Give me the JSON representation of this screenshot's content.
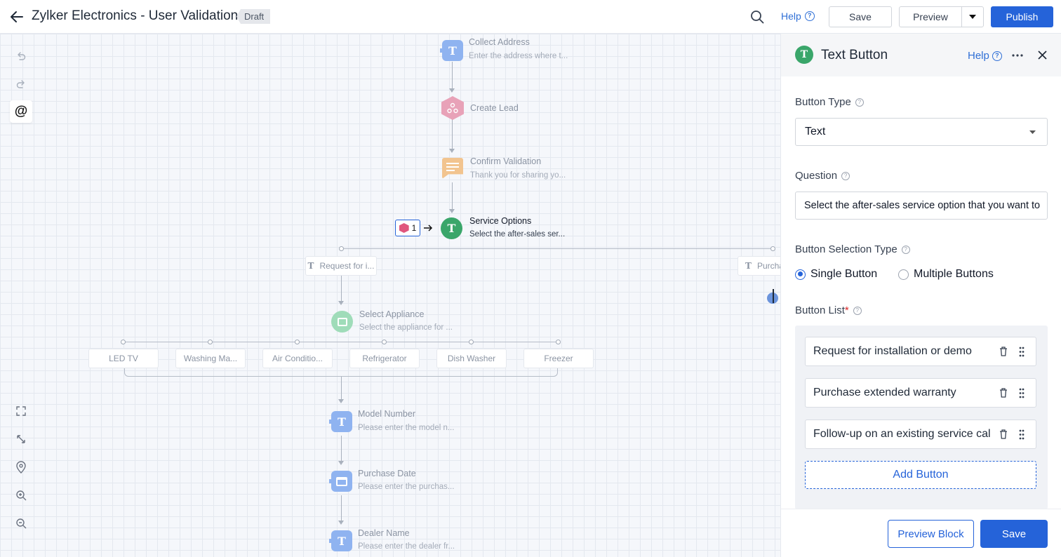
{
  "header": {
    "title": "Zylker Electronics - User Validation",
    "badge": "Draft",
    "help": "Help",
    "save": "Save",
    "preview": "Preview",
    "publish": "Publish"
  },
  "flow": {
    "collect_address": {
      "title": "Collect Address",
      "sub": "Enter the address where t..."
    },
    "create_lead": {
      "title": "Create Lead"
    },
    "confirm_validation": {
      "title": "Confirm Validation",
      "sub": "Thank you for sharing yo..."
    },
    "service_options": {
      "title": "Service Options",
      "sub": "Select the after-sales ser...",
      "badge_count": "1"
    },
    "branch_left": "Request for i...",
    "branch_right": "Purcha",
    "select_appliance": {
      "title": "Select Appliance",
      "sub": "Select the appliance for ..."
    },
    "appliances": [
      "LED TV",
      "Washing Ma...",
      "Air Conditio...",
      "Refrigerator",
      "Dish Washer",
      "Freezer"
    ],
    "model_number": {
      "title": "Model Number",
      "sub": "Please enter the model n..."
    },
    "purchase_date": {
      "title": "Purchase Date",
      "sub": "Please enter the purchas..."
    },
    "dealer_name": {
      "title": "Dealer Name",
      "sub": "Please enter the dealer fr..."
    }
  },
  "panel": {
    "title": "Text Button",
    "help": "Help",
    "button_type_label": "Button Type",
    "button_type_value": "Text",
    "question_label": "Question",
    "question_value": "Select the after-sales service option that you want to",
    "selection_type_label": "Button Selection Type",
    "single": "Single Button",
    "multiple": "Multiple Buttons",
    "selected": "single",
    "button_list_label": "Button List",
    "required_mark": "*",
    "buttons": [
      "Request for installation or demo",
      "Purchase extended warranty",
      "Follow-up on an existing service cal"
    ],
    "add_button": "Add Button",
    "preview_block": "Preview Block",
    "save": "Save"
  },
  "colors": {
    "primary": "#2563d9",
    "text_node": "#8fb3f0",
    "webhook_node": "#e8a2b8",
    "message_node": "#f2c48f",
    "service_node": "#3aa66a",
    "appliance_node": "#9fdcb9"
  }
}
